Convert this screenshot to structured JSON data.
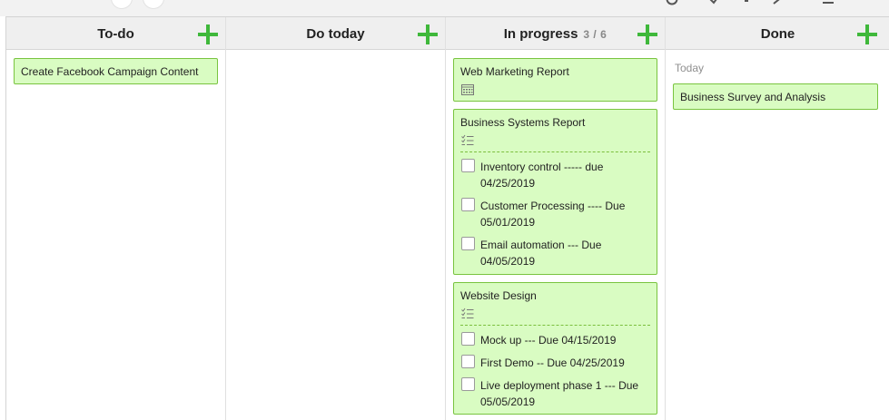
{
  "board": {
    "columns": [
      {
        "title": "To-do",
        "count": "",
        "cards": [
          {
            "title": "Create Facebook Campaign Content"
          }
        ]
      },
      {
        "title": "Do today",
        "count": "",
        "cards": []
      },
      {
        "title": "In progress",
        "count": "3 / 6",
        "cards": [
          {
            "title": "Web Marketing Report",
            "icon": "calendar-icon"
          },
          {
            "title": "Business Systems Report",
            "icon": "checklist-icon",
            "checklist": [
              {
                "text": "Inventory control ----- due 04/25/2019",
                "checked": false
              },
              {
                "text": "Customer Processing ---- Due 05/01/2019",
                "checked": false
              },
              {
                "text": "Email automation --- Due 04/05/2019",
                "checked": false
              }
            ]
          },
          {
            "title": "Website Design",
            "icon": "checklist-icon",
            "checklist": [
              {
                "text": "Mock up --- Due 04/15/2019",
                "checked": false
              },
              {
                "text": "First Demo -- Due 04/25/2019",
                "checked": false
              },
              {
                "text": "Live deployment phase 1 --- Due 05/05/2019",
                "checked": false
              }
            ]
          }
        ]
      },
      {
        "title": "Done",
        "count": "",
        "section": "Today",
        "cards": [
          {
            "title": "Business Survey and Analysis"
          }
        ]
      }
    ]
  },
  "colors": {
    "card_bg": "#d9fcc2",
    "card_border": "#79c43f",
    "add_icon": "#3fb83b",
    "header_bg": "#efefef"
  }
}
